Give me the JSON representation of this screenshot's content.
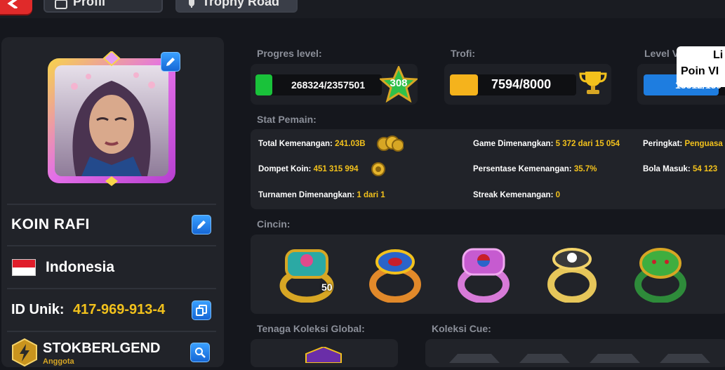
{
  "nav": {
    "tab_profil_label": "Profil",
    "tab_trophy_label": "Trophy Road"
  },
  "profile": {
    "name": "KOIN RAFI",
    "country": "Indonesia",
    "id_label": "ID Unik:",
    "id_value": "417-969-913-4",
    "club_name": "STOKBERLGEND",
    "club_role": "Anggota"
  },
  "labels": {
    "progres_level": "Progres level:",
    "trofi": "Trofi:",
    "level_vip": "Level VIP:",
    "stat_pemain": "Stat Pemain:",
    "cincin": "Cincin:",
    "tenaga_koleksi": "Tenaga Koleksi Global:",
    "koleksi_cue": "Koleksi Cue:"
  },
  "progress": {
    "level_text": "268324/2357501",
    "level_fraction": 0.114,
    "level_badge": "308",
    "trofi_text": "7594/8000",
    "trofi_fraction": 0.949,
    "vip_text": "13312/150",
    "vip_fraction": 0.89
  },
  "stats": {
    "total_kemenangan_label": "Total Kemenangan:",
    "total_kemenangan_value": "241.03B",
    "dompet_koin_label": "Dompet Koin:",
    "dompet_koin_value": "451 315 994",
    "turnamen_label": "Turnamen Dimenangkan:",
    "turnamen_value": "1 dari 1",
    "game_label": "Game Dimenangkan:",
    "game_value": "5 372 dari 15 054",
    "persentase_label": "Persentase Kemenangan:",
    "persentase_value": "35.7%",
    "streak_label": "Streak Kemenangan:",
    "streak_value": "0",
    "peringkat_label": "Peringkat:",
    "peringkat_value": "Penguasa",
    "bola_label": "Bola Masuk:",
    "bola_value": "54 123"
  },
  "rings": {
    "first_count": "50"
  },
  "tooltip": {
    "line1": "Li",
    "line2": "Poin VI"
  },
  "colors": {
    "accent_yellow": "#f2c11c",
    "level_green": "#19c23a",
    "trofi_orange": "#f5b31c",
    "vip_blue": "#1e7de0",
    "edit_blue": "#1e7de0"
  }
}
